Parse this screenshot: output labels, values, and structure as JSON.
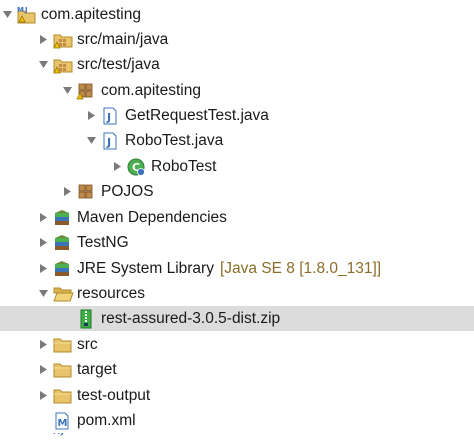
{
  "tree": {
    "colors": {
      "folder": "#e9c46a",
      "package": "#c08a4a",
      "java_blue": "#3b73b9",
      "class_green": "#4caf50",
      "zip_green": "#3cb043",
      "decoration": "#8a6d2a",
      "selected_bg": "#dcdcdc"
    },
    "items": [
      {
        "label": "com.apitesting",
        "icon": "maven-project-icon",
        "state": "expanded"
      },
      {
        "label": "src/main/java",
        "icon": "source-folder-icon",
        "state": "collapsed"
      },
      {
        "label": "src/test/java",
        "icon": "source-folder-icon",
        "state": "expanded"
      },
      {
        "label": "com.apitesting",
        "icon": "package-icon",
        "state": "expanded"
      },
      {
        "label": "GetRequestTest.java",
        "icon": "java-file-icon",
        "state": "collapsed"
      },
      {
        "label": "RoboTest.java",
        "icon": "java-file-icon",
        "state": "expanded"
      },
      {
        "label": "RoboTest",
        "icon": "java-class-icon",
        "state": "collapsed"
      },
      {
        "label": "POJOS",
        "icon": "package-icon",
        "state": "collapsed"
      },
      {
        "label": "Maven Dependencies",
        "icon": "library-icon",
        "state": "collapsed"
      },
      {
        "label": "TestNG",
        "icon": "library-icon",
        "state": "collapsed"
      },
      {
        "label": "JRE System Library",
        "decoration": "[Java SE 8 [1.8.0_131]]",
        "icon": "library-icon",
        "state": "collapsed"
      },
      {
        "label": "resources",
        "icon": "folder-open-icon",
        "state": "expanded"
      },
      {
        "label": "rest-assured-3.0.5-dist.zip",
        "icon": "zip-file-icon",
        "state": "none",
        "selected": true
      },
      {
        "label": "src",
        "icon": "folder-icon",
        "state": "collapsed"
      },
      {
        "label": "target",
        "icon": "folder-icon",
        "state": "collapsed"
      },
      {
        "label": "test-output",
        "icon": "folder-icon",
        "state": "collapsed"
      },
      {
        "label": "pom.xml",
        "icon": "maven-file-icon",
        "state": "none"
      }
    ]
  }
}
